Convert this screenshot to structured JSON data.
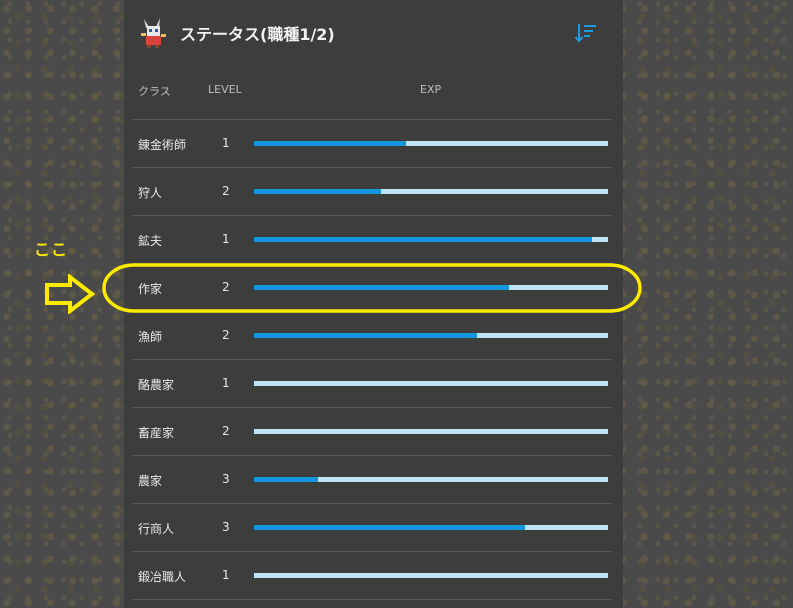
{
  "header": {
    "title": "ステータス(職種1/2)",
    "sort_icon": "sort-descending-icon",
    "avatar_icon": "character-sprite-icon"
  },
  "columns": {
    "class": "クラス",
    "level": "LEVEL",
    "exp": "EXP"
  },
  "rows": [
    {
      "name": "錬金術師",
      "level": "1",
      "exp_progress": 0.43
    },
    {
      "name": "狩人",
      "level": "2",
      "exp_progress": 0.36
    },
    {
      "name": "鉱夫",
      "level": "1",
      "exp_progress": 0.955
    },
    {
      "name": "作家",
      "level": "2",
      "exp_progress": 0.72
    },
    {
      "name": "漁師",
      "level": "2",
      "exp_progress": 0.63
    },
    {
      "name": "酪農家",
      "level": "1",
      "exp_progress": 0.0
    },
    {
      "name": "畜産家",
      "level": "2",
      "exp_progress": 0.0
    },
    {
      "name": "農家",
      "level": "3",
      "exp_progress": 0.18
    },
    {
      "name": "行商人",
      "level": "3",
      "exp_progress": 0.765
    },
    {
      "name": "鍛冶職人",
      "level": "1",
      "exp_progress": 0.0
    }
  ],
  "annotation": {
    "label": "ここ",
    "color": "#ffeb00"
  },
  "colors": {
    "panel": "#3d3d3d",
    "bar_fill": "#1296dd",
    "bar_track": "#bde3f4"
  }
}
